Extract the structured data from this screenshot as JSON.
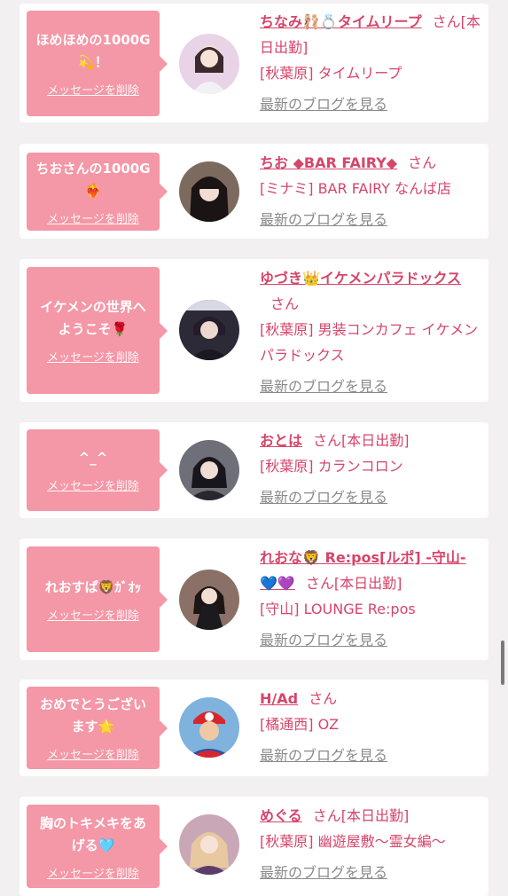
{
  "delete_label": "メッセージを削除",
  "blog_label": "最新のブログを見る",
  "san": "さん",
  "cards": [
    {
      "message": "ほめほめの1000G💫！",
      "name": "ちなみ🩰💍タイムリープ",
      "status": "[本日出勤]",
      "shop": "[秋葉原] タイムリープ"
    },
    {
      "message": "ちおさんの1000G❤️‍🔥",
      "name": "ちお ◆BAR FAIRY◆",
      "status": "",
      "shop": "[ミナミ] BAR FAIRY なんば店"
    },
    {
      "message": "イケメンの世界へようこそ🌹",
      "name": "ゆづき👑イケメンパラドックス",
      "status": "",
      "shop": "[秋葉原] 男装コンカフェ イケメンパラドックス"
    },
    {
      "message": "^_^",
      "name": "おとは",
      "status": "[本日出勤]",
      "shop": "[秋葉原] カランコロン"
    },
    {
      "message": "れおすぱ🦁ｶﾞｵｯ",
      "name": "れおな🦁 Re:pos[ルポ] -守山-💙💜",
      "status": "[本日出勤]",
      "shop": "[守山] LOUNGE Re:pos"
    },
    {
      "message": "おめでとうございます🌟",
      "name": "H/Ad",
      "status": "",
      "shop": "[橘通西] OZ"
    },
    {
      "message": "胸のトキメキをあげる🩵",
      "name": "めぐる",
      "status": "[本日出勤]",
      "shop": "[秋葉原] 幽遊屋敷〜霊女編〜"
    }
  ]
}
